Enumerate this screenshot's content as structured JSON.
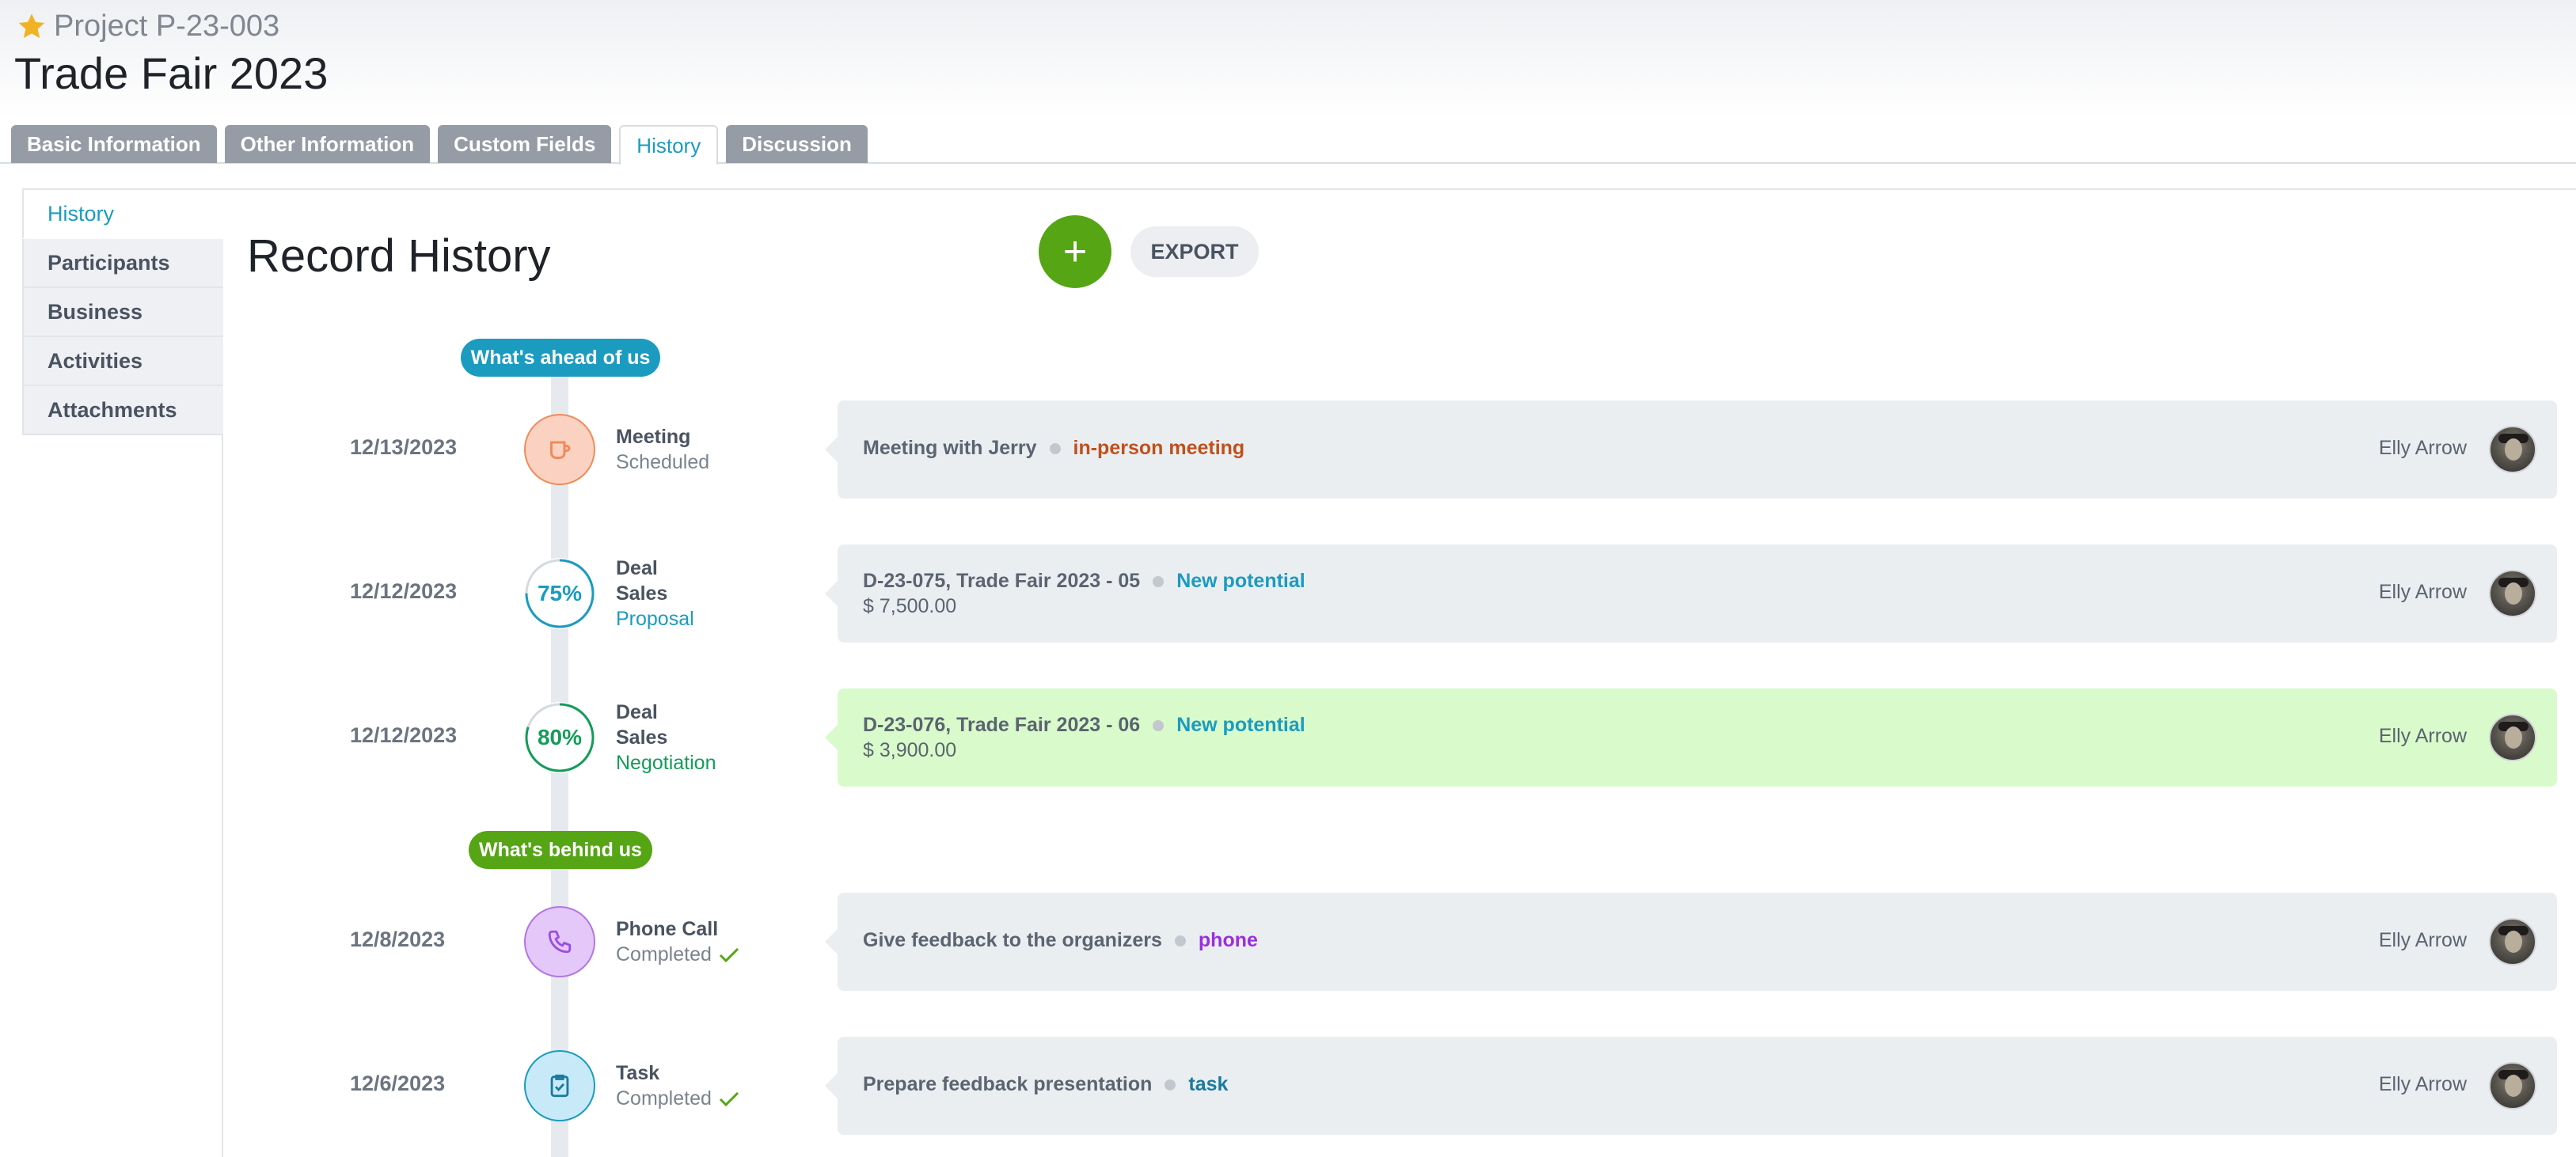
{
  "header": {
    "project_code": "Project P-23-003",
    "title": "Trade Fair 2023"
  },
  "tabs": [
    {
      "label": "Basic Information",
      "active": false
    },
    {
      "label": "Other Information",
      "active": false
    },
    {
      "label": "Custom Fields",
      "active": false
    },
    {
      "label": "History",
      "active": true
    },
    {
      "label": "Discussion",
      "active": false
    }
  ],
  "sidebar": {
    "items": [
      {
        "label": "History",
        "active": true
      },
      {
        "label": "Participants",
        "active": false
      },
      {
        "label": "Business",
        "active": false
      },
      {
        "label": "Activities",
        "active": false
      },
      {
        "label": "Attachments",
        "active": false
      }
    ]
  },
  "main": {
    "title": "Record History",
    "add_button": "+",
    "export_button": "EXPORT",
    "ahead_label": "What's ahead of us",
    "behind_label": "What's behind us"
  },
  "timeline": [
    {
      "date": "12/13/2023",
      "icon": "cup-icon",
      "type": "Meeting",
      "status": "Scheduled",
      "title": "Meeting with Jerry",
      "tag": "in-person meeting",
      "user": "Elly Arrow"
    },
    {
      "date": "12/12/2023",
      "progress": "75%",
      "progress_value": 0.75,
      "type": "Deal",
      "subtype": "Sales",
      "status": "Proposal",
      "title": "D-23-075, Trade Fair 2023 - 05",
      "tag": "New potential",
      "amount": "$ 7,500.00",
      "user": "Elly Arrow"
    },
    {
      "date": "12/12/2023",
      "progress": "80%",
      "progress_value": 0.8,
      "type": "Deal",
      "subtype": "Sales",
      "status": "Negotiation",
      "title": "D-23-076, Trade Fair 2023 - 06",
      "tag": "New potential",
      "amount": "$ 3,900.00",
      "user": "Elly Arrow"
    },
    {
      "date": "12/8/2023",
      "icon": "phone-icon",
      "type": "Phone Call",
      "status": "Completed",
      "title": "Give feedback to the organizers",
      "tag": "phone",
      "user": "Elly Arrow"
    },
    {
      "date": "12/6/2023",
      "icon": "clipboard-check-icon",
      "type": "Task",
      "status": "Completed",
      "title": "Prepare feedback presentation",
      "tag": "task",
      "user": "Elly Arrow"
    }
  ],
  "colors": {
    "accent_blue": "#1b9bc0",
    "accent_green": "#55a514",
    "highlight_card": "#d9fbcb"
  }
}
